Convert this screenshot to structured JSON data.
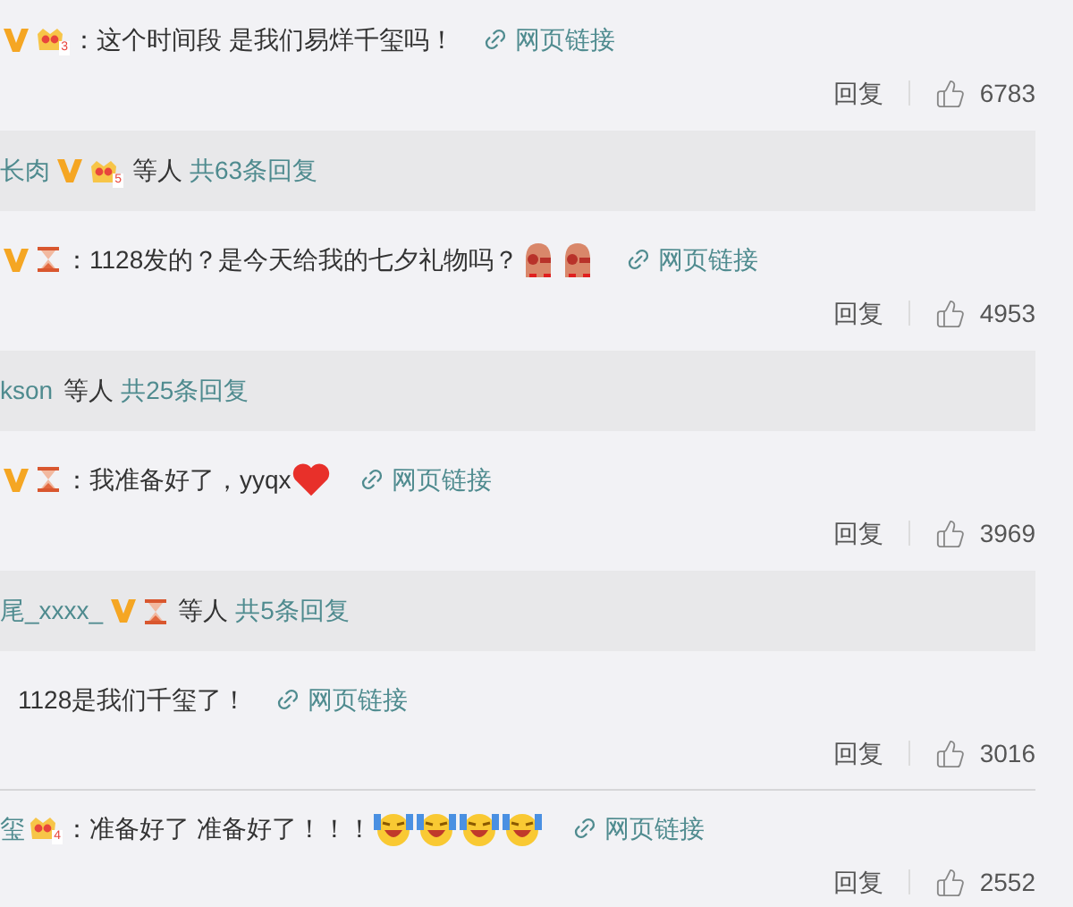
{
  "comments": [
    {
      "badges": [
        {
          "kind": "vip"
        },
        {
          "kind": "crown",
          "level": "3"
        }
      ],
      "text": "：这个时间段 是我们易烊千玺吗！",
      "link": "网页链接",
      "reply": "回复",
      "likes": "6783",
      "divider": false,
      "replies_bar": {
        "author": "长肉",
        "badges": [
          {
            "kind": "vip"
          },
          {
            "kind": "crown",
            "level": "5"
          }
        ],
        "suffix": "等人",
        "count": "共63条回复"
      }
    },
    {
      "badges": [
        {
          "kind": "vip"
        },
        {
          "kind": "hourglass"
        }
      ],
      "text": "：1128发的？是今天给我的七夕礼物吗？",
      "emojis": [
        {
          "kind": "sticker"
        },
        {
          "kind": "sticker"
        }
      ],
      "link": "网页链接",
      "reply": "回复",
      "likes": "4953",
      "divider": false,
      "replies_bar": {
        "author": "kson",
        "suffix": "等人",
        "count": "共25条回复"
      }
    },
    {
      "badges": [
        {
          "kind": "vip"
        },
        {
          "kind": "hourglass"
        }
      ],
      "text": "：我准备好了，yyqx",
      "emojis": [
        {
          "kind": "heart"
        }
      ],
      "link": "网页链接",
      "reply": "回复",
      "likes": "3969",
      "divider": false,
      "replies_bar": {
        "author": "尾_xxxx_",
        "badges": [
          {
            "kind": "vip"
          },
          {
            "kind": "hourglass"
          }
        ],
        "suffix": "等人",
        "count": "共5条回复"
      }
    },
    {
      "text": "1128是我们千玺了！",
      "link": "网页链接",
      "reply": "回复",
      "likes": "3016",
      "divider": true
    },
    {
      "author": "玺",
      "badges": [
        {
          "kind": "crown",
          "level": "4"
        }
      ],
      "text": "：准备好了 准备好了！！！",
      "emojis": [
        {
          "kind": "laugh"
        },
        {
          "kind": "laugh"
        },
        {
          "kind": "laugh"
        },
        {
          "kind": "laugh"
        }
      ],
      "link": "网页链接",
      "reply": "回复",
      "likes": "2552",
      "divider": false
    }
  ]
}
